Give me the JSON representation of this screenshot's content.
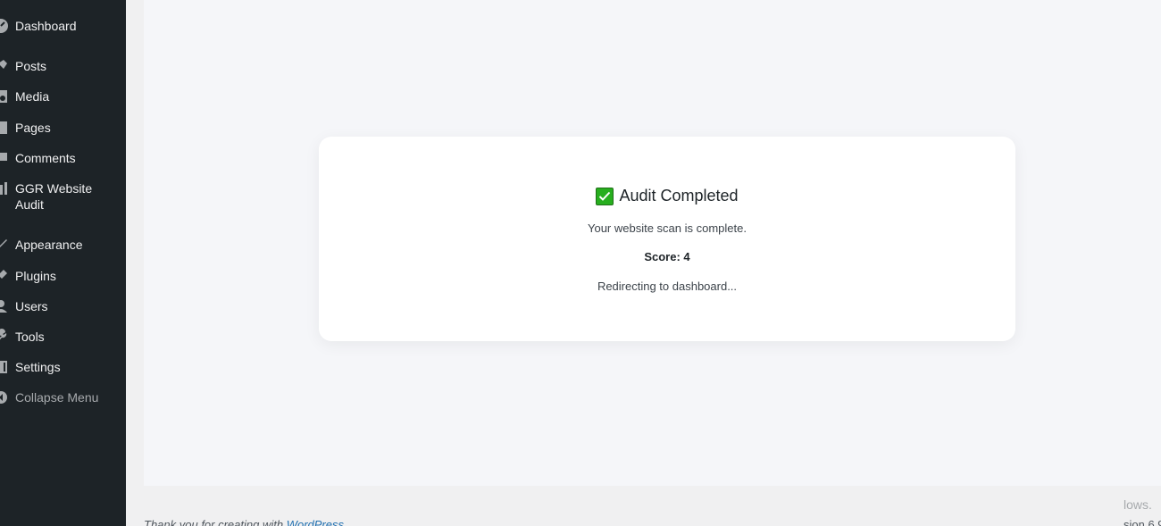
{
  "sidebar": {
    "items": [
      {
        "label": "Dashboard",
        "icon": "dashboard-icon"
      },
      {
        "label": "Posts",
        "icon": "pin-icon"
      },
      {
        "label": "Media",
        "icon": "media-icon"
      },
      {
        "label": "Pages",
        "icon": "page-icon"
      },
      {
        "label": "Comments",
        "icon": "comment-icon"
      },
      {
        "label": "GGR Website Audit",
        "icon": "chart-icon"
      },
      {
        "label": "Appearance",
        "icon": "brush-icon"
      },
      {
        "label": "Plugins",
        "icon": "plugin-icon"
      },
      {
        "label": "Users",
        "icon": "user-icon"
      },
      {
        "label": "Tools",
        "icon": "wrench-icon"
      },
      {
        "label": "Settings",
        "icon": "settings-icon"
      },
      {
        "label": "Collapse Menu",
        "icon": "collapse-icon"
      }
    ]
  },
  "card": {
    "title": "Audit Completed",
    "message": "Your website scan is complete.",
    "score": "Score: 4",
    "redirect": "Redirecting to dashboard..."
  },
  "footer": {
    "thanks_prefix": "Thank you for creating with ",
    "thanks_link": "WordPress",
    "right_line_1": "lows.",
    "right_line_2": "sion 6.9"
  },
  "colors": {
    "sidebar_bg": "#1d2327",
    "content_bg": "#f5f6f9",
    "check_green": "#27ae1e",
    "link": "#2271b1"
  }
}
